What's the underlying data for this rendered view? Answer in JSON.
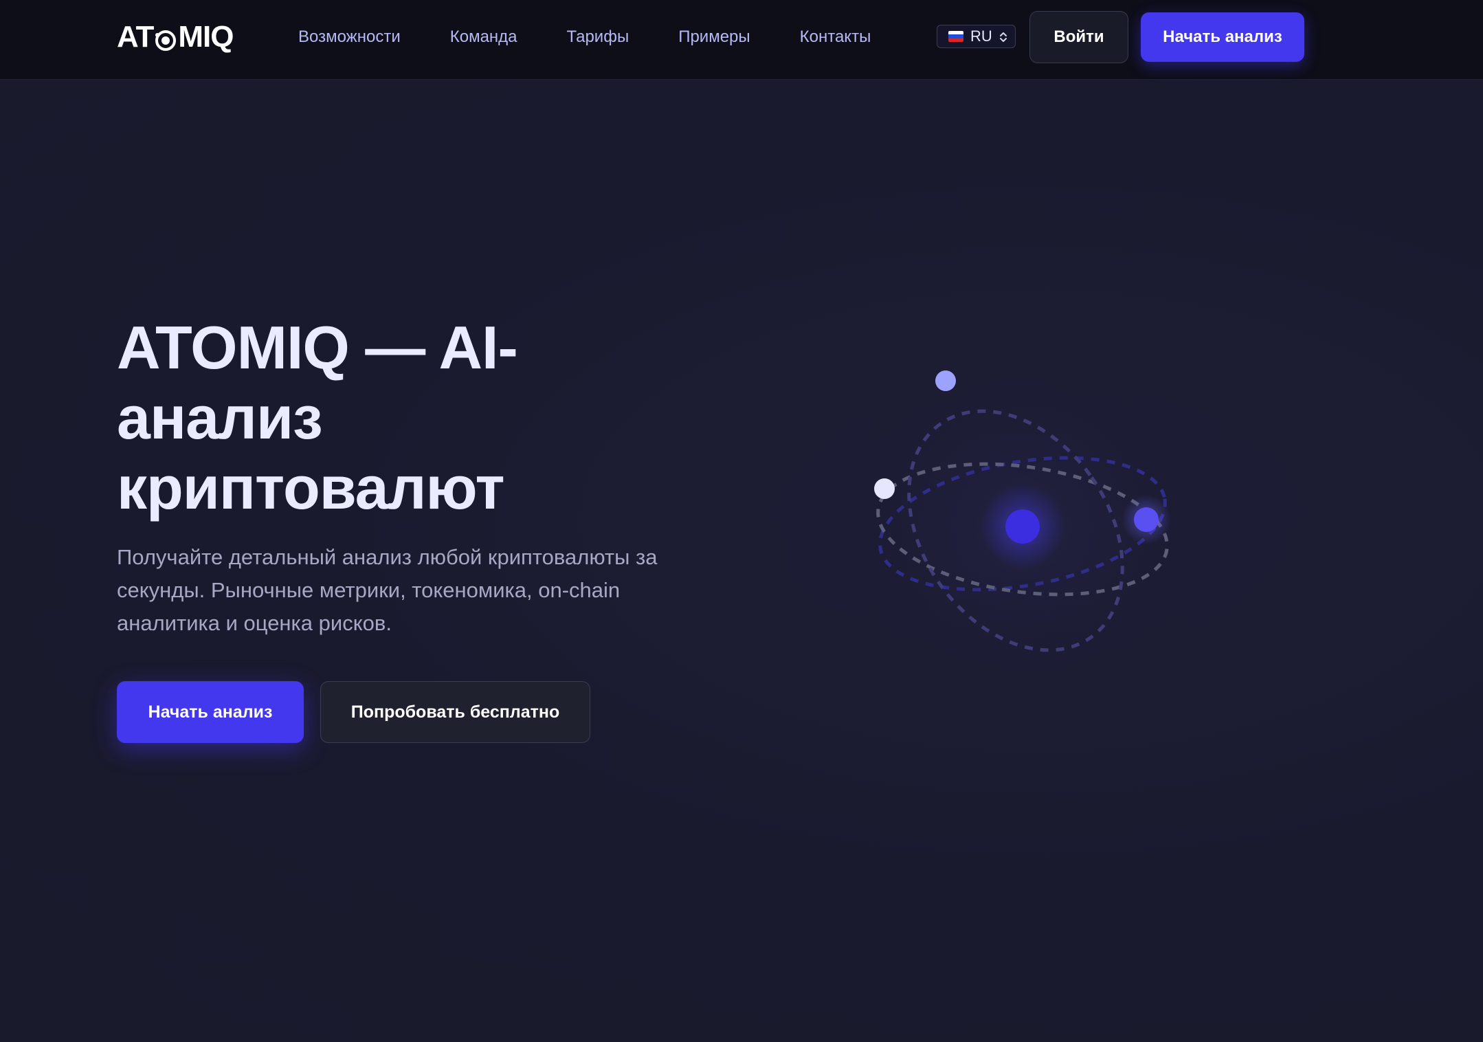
{
  "header": {
    "brand": "ATOMIQ",
    "brand_parts": {
      "pre": "AT",
      "post": "MIQ"
    },
    "nav": [
      {
        "label": "Возможности"
      },
      {
        "label": "Команда"
      },
      {
        "label": "Тарифы"
      },
      {
        "label": "Примеры"
      },
      {
        "label": "Контакты"
      }
    ],
    "language": {
      "selected": "RU"
    },
    "login_label": "Войти",
    "start_label": "Начать анализ"
  },
  "hero": {
    "title": "ATOMIQ — AI-анализ криптовалют",
    "subtitle": "Получайте детальный анализ любой криптовалюты за секунды. Рыночные метрики, токеномика, on-chain аналитика и оценка рисков.",
    "primary_button": "Начать анализ",
    "secondary_button": "Попробовать бесплатно"
  },
  "colors": {
    "background": "#1a1a2e",
    "navbar": "#0d0e18",
    "accent": "#4338ee",
    "nav_link": "#b7b9f3",
    "title": "#ebebff",
    "subtitle": "#a6a8c4"
  },
  "icons": {
    "logo": "atom-logo-icon",
    "language_flag": "russia-flag-icon",
    "select_arrows": "up-down-chevron-icon",
    "illustration": "atom-orbit-illustration"
  }
}
